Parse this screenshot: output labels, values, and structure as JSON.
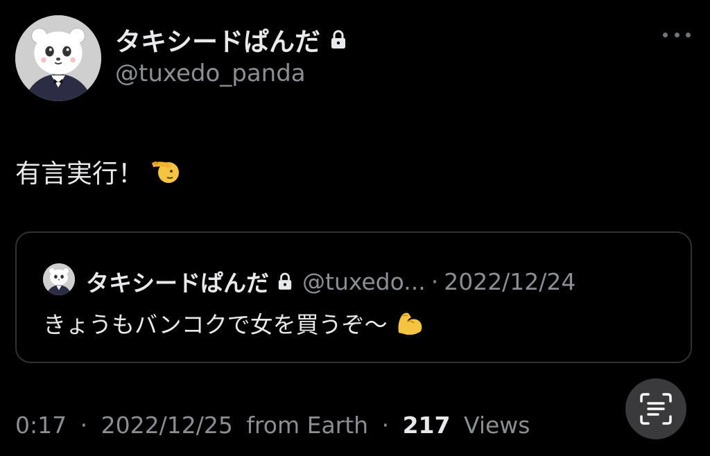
{
  "author": {
    "display_name": "タキシードぱんだ",
    "handle": "@tuxedo_panda",
    "protected_icon": "lock-icon",
    "avatar_icon": "panda-avatar"
  },
  "actions": {
    "more_icon": "more-icon"
  },
  "tweet": {
    "text": "有言実行！",
    "emoji": "saluting-face"
  },
  "quote": {
    "display_name": "タキシードぱんだ",
    "handle": "@tuxedo...",
    "separator": "·",
    "date": "2022/12/24",
    "text": "きょうもバンコクで女を買うぞ〜",
    "emoji": "flexed-biceps"
  },
  "meta": {
    "time": "0:17",
    "separator1": "·",
    "date": "2022/12/25",
    "source": "from Earth",
    "separator2": "·",
    "views_count": "217",
    "views_label": "Views"
  },
  "overlay": {
    "scan_icon": "text-scan-icon"
  },
  "colors": {
    "background": "#000000",
    "text_primary": "#e7e9ea",
    "text_secondary": "#8b8f94",
    "border": "#2f3336"
  }
}
